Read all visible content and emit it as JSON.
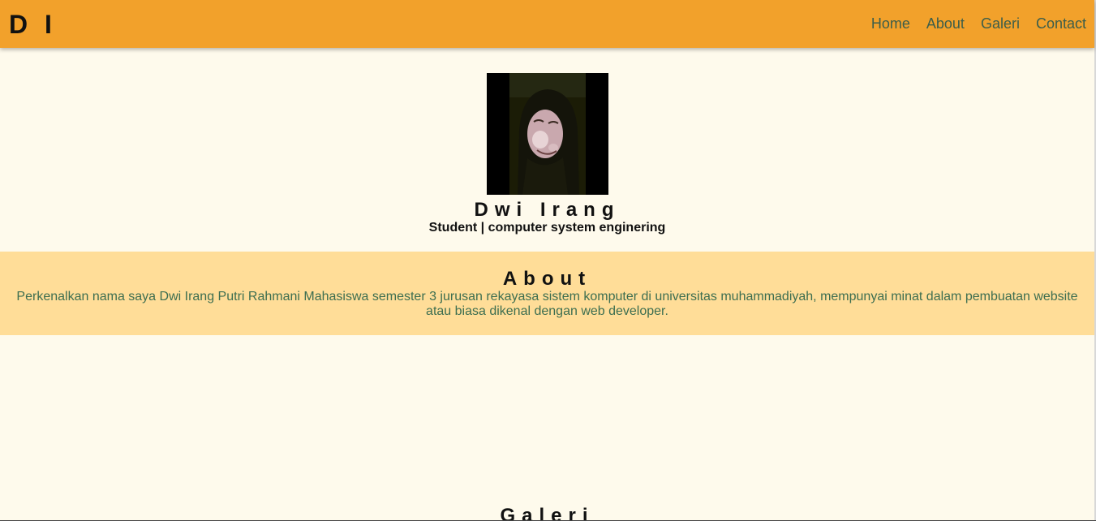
{
  "navbar": {
    "brand": "D I",
    "links": [
      {
        "label": "Home"
      },
      {
        "label": "About"
      },
      {
        "label": "Galeri"
      },
      {
        "label": "Contact"
      }
    ]
  },
  "profile": {
    "name": "Dwi Irang",
    "subtitle": "Student | computer system enginering"
  },
  "about": {
    "title": "About",
    "text": "Perkenalkan nama saya Dwi Irang Putri Rahmani Mahasiswa semester 3 jurusan rekayasa sistem komputer di universitas muhammadiyah, mempunyai minat dalam pembuatan website atau biasa dikenal dengan web developer."
  },
  "galeri": {
    "title": "Galeri"
  },
  "colors": {
    "navbar": "#f2a12b",
    "page_background": "#fefaec",
    "about_background": "#ffdd98",
    "link": "#3d5e4a"
  }
}
